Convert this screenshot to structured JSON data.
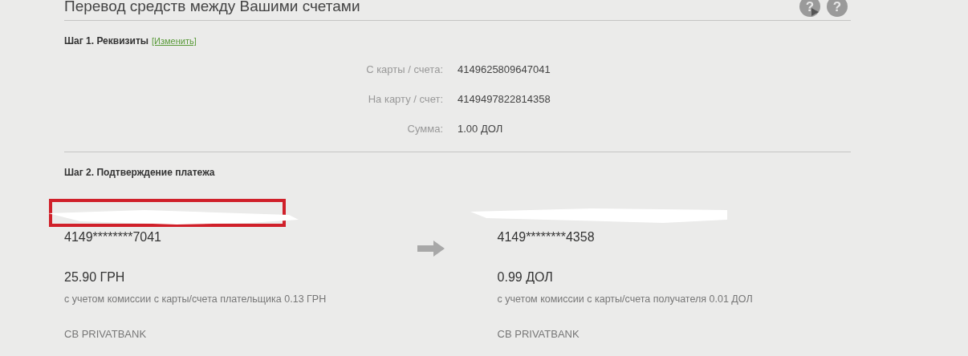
{
  "title": "Перевод средств между Вашими счетами",
  "help_buttons": [
    {
      "kind": "video",
      "label": "?"
    },
    {
      "kind": "plain",
      "label": "?"
    }
  ],
  "step1": {
    "heading": "Шаг 1. Реквизиты",
    "change_link": "[Изменить]",
    "fields": [
      {
        "label": "С карты / счета:",
        "value": "4149625809647041"
      },
      {
        "label": "На карту / счет:",
        "value": "4149497822814358"
      },
      {
        "label": "Сумма:",
        "value": "1.00 ДОЛ"
      }
    ]
  },
  "step2": {
    "heading": "Шаг 2. Подтверждение платежа",
    "accounts": [
      {
        "highlighted": true,
        "card": "4149********7041",
        "amount": "25.90 ГРН",
        "commission": "с учетом комиссии с карты/счета плательщика 0.13 ГРН",
        "bank": "CB PRIVATBANK"
      },
      {
        "highlighted": false,
        "card": "4149********4358",
        "amount": "0.99 ДОЛ",
        "commission": "с учетом комиссии с карты/счета получателя 0.01 ДОЛ",
        "bank": "CB PRIVATBANK"
      }
    ]
  }
}
